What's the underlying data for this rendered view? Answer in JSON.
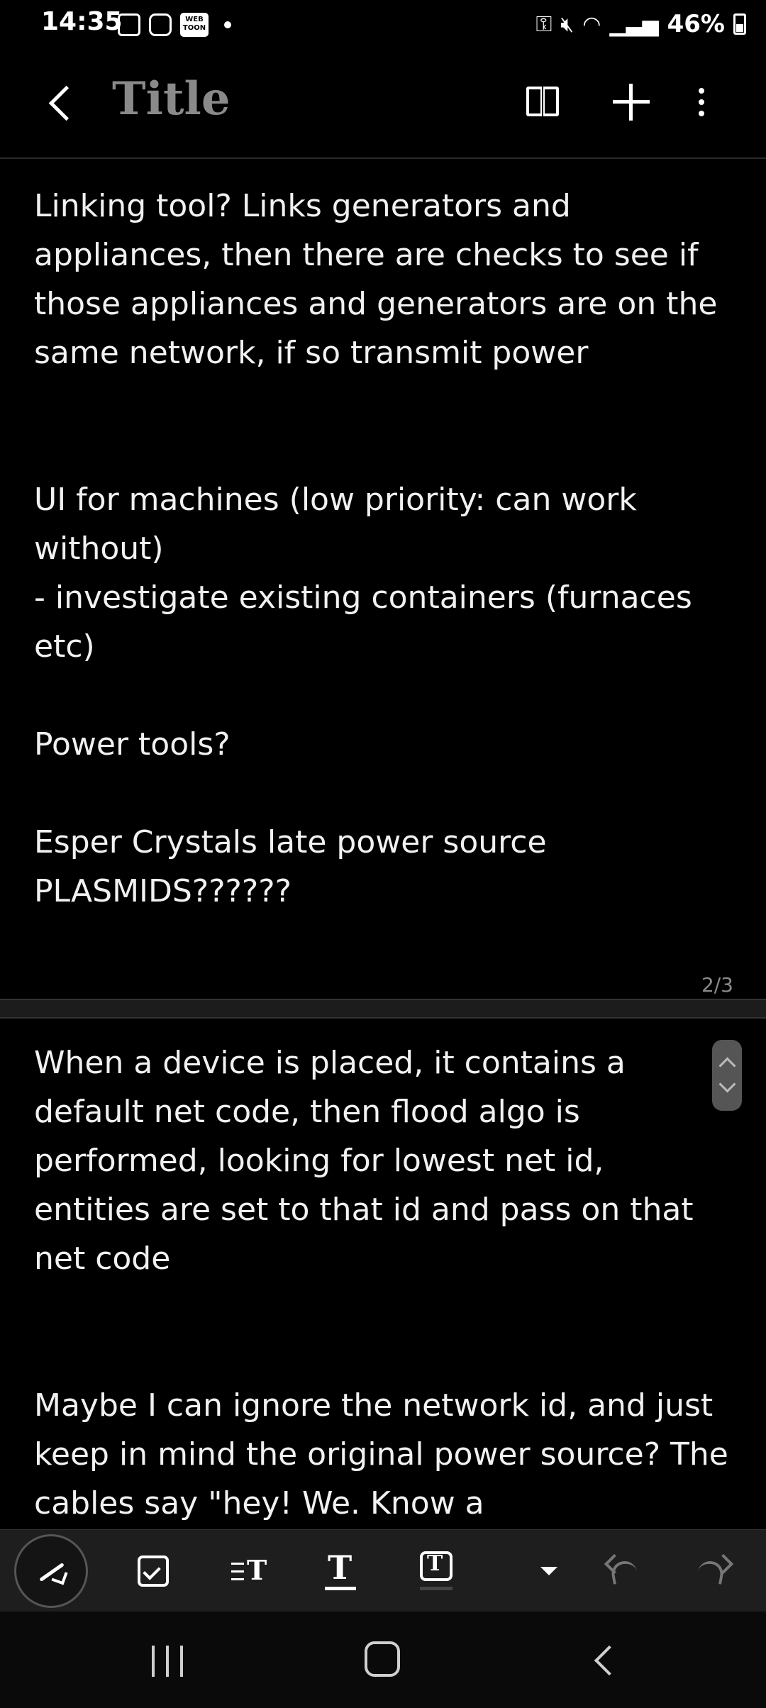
{
  "status_bar": {
    "time": "14:35",
    "webtoon_badge": "WEB TOON",
    "battery": "46%"
  },
  "app_bar": {
    "title": "Title",
    "icons": [
      "back-icon",
      "book-icon",
      "plus-icon",
      "more-vertical-icon"
    ]
  },
  "page1": {
    "text": "Linking tool? Links generators and appliances, then there are checks to see if those appliances and generators are on the same network, if so transmit power\n\n\nUI for machines (low priority: can work without)\n- investigate existing containers (furnaces etc)\n\nPower tools?\n\nEsper Crystals late power source\nPLASMIDS??????"
  },
  "page_indicator": "2/3",
  "page2": {
    "text": "When a device is placed, it contains a default net code, then flood algo is performed, looking for lowest net id, entities are set to that id and pass on that net code\n\n\nMaybe I can ignore the network id, and just keep in mind the original power source? The cables say \"hey! We. Know a"
  },
  "toolbar": {
    "icons": [
      "pen-icon",
      "checkbox-icon",
      "text-size-icon",
      "text-style-icon",
      "text-box-icon",
      "dropdown-icon",
      "undo-icon",
      "redo-icon"
    ]
  },
  "nav_bar": {
    "icons": [
      "recents-icon",
      "home-icon",
      "back-icon"
    ]
  },
  "colors": {
    "background": "#000000",
    "toolbar_bg": "#1e1e1e",
    "title_color": "#8a8a8a",
    "text": "#f1f1f1"
  }
}
